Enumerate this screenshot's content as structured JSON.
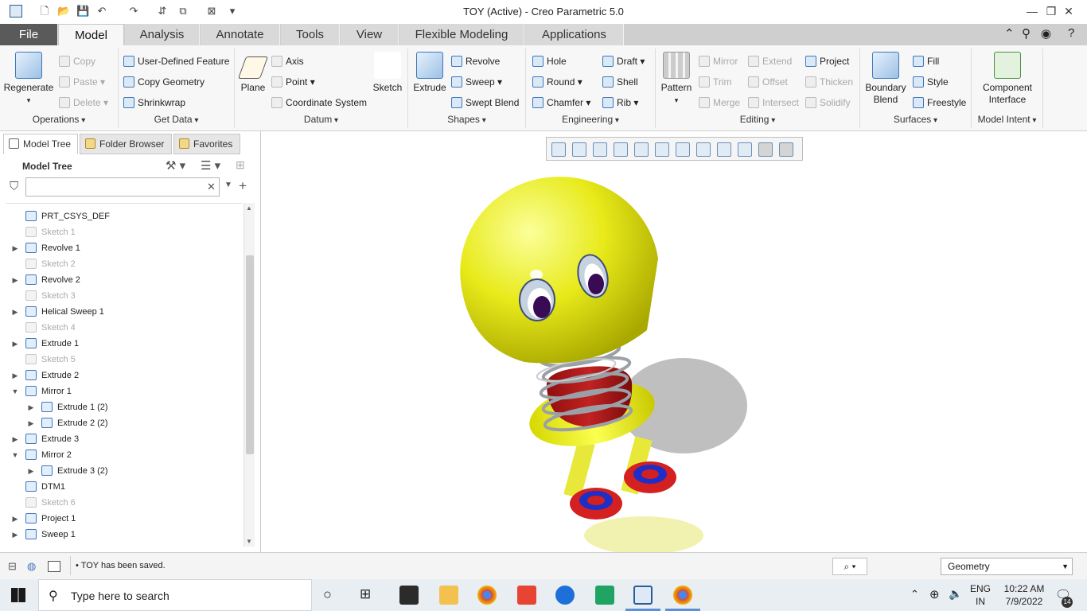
{
  "window": {
    "title": "TOY (Active) - Creo Parametric 5.0"
  },
  "tabs": [
    {
      "label": "File"
    },
    {
      "label": "Model"
    },
    {
      "label": "Analysis"
    },
    {
      "label": "Annotate"
    },
    {
      "label": "Tools"
    },
    {
      "label": "View"
    },
    {
      "label": "Flexible Modeling"
    },
    {
      "label": "Applications"
    }
  ],
  "ribbon": {
    "operations": {
      "label": "Operations",
      "regenerate": "Regenerate",
      "copy": "Copy",
      "paste": "Paste",
      "delete": "Delete"
    },
    "get_data": {
      "label": "Get Data",
      "udf": "User-Defined Feature",
      "copy_geometry": "Copy Geometry",
      "shrinkwrap": "Shrinkwrap"
    },
    "datum": {
      "label": "Datum",
      "plane": "Plane",
      "axis": "Axis",
      "point": "Point",
      "csys": "Coordinate System",
      "sketch": "Sketch"
    },
    "shapes": {
      "label": "Shapes",
      "extrude": "Extrude",
      "revolve": "Revolve",
      "sweep": "Sweep",
      "swept_blend": "Swept Blend"
    },
    "engineering": {
      "label": "Engineering",
      "hole": "Hole",
      "round": "Round",
      "chamfer": "Chamfer",
      "draft": "Draft",
      "shell": "Shell",
      "rib": "Rib"
    },
    "editing": {
      "label": "Editing",
      "pattern": "Pattern",
      "mirror": "Mirror",
      "trim": "Trim",
      "merge": "Merge",
      "extend": "Extend",
      "offset": "Offset",
      "intersect": "Intersect",
      "project": "Project",
      "thicken": "Thicken",
      "solidify": "Solidify"
    },
    "surfaces": {
      "label": "Surfaces",
      "boundary_blend_1": "Boundary",
      "boundary_blend_2": "Blend",
      "fill": "Fill",
      "style": "Style",
      "freestyle": "Freestyle"
    },
    "model_intent": {
      "label": "Model Intent",
      "component_interface_1": "Component",
      "component_interface_2": "Interface"
    }
  },
  "panel": {
    "tabs": [
      {
        "label": "Model Tree"
      },
      {
        "label": "Folder Browser"
      },
      {
        "label": "Favorites"
      }
    ],
    "title": "Model Tree",
    "filter_placeholder": "",
    "items": [
      {
        "label": "PRT_CSYS_DEF",
        "dim": false,
        "exp": ""
      },
      {
        "label": "Sketch 1",
        "dim": true,
        "exp": ""
      },
      {
        "label": "Revolve 1",
        "dim": false,
        "exp": "▶"
      },
      {
        "label": "Sketch 2",
        "dim": true,
        "exp": ""
      },
      {
        "label": "Revolve 2",
        "dim": false,
        "exp": "▶"
      },
      {
        "label": "Sketch 3",
        "dim": true,
        "exp": ""
      },
      {
        "label": "Helical Sweep 1",
        "dim": false,
        "exp": "▶"
      },
      {
        "label": "Sketch 4",
        "dim": true,
        "exp": ""
      },
      {
        "label": "Extrude 1",
        "dim": false,
        "exp": "▶"
      },
      {
        "label": "Sketch 5",
        "dim": true,
        "exp": ""
      },
      {
        "label": "Extrude 2",
        "dim": false,
        "exp": "▶"
      },
      {
        "label": "Mirror 1",
        "dim": false,
        "exp": "▼"
      },
      {
        "label": "Extrude 1 (2)",
        "dim": false,
        "exp": "▶",
        "indent": 1
      },
      {
        "label": "Extrude 2 (2)",
        "dim": false,
        "exp": "▶",
        "indent": 1
      },
      {
        "label": "Extrude 3",
        "dim": false,
        "exp": "▶"
      },
      {
        "label": "Mirror 2",
        "dim": false,
        "exp": "▼"
      },
      {
        "label": "Extrude 3 (2)",
        "dim": false,
        "exp": "▶",
        "indent": 1
      },
      {
        "label": "DTM1",
        "dim": false,
        "exp": ""
      },
      {
        "label": "Sketch 6",
        "dim": true,
        "exp": ""
      },
      {
        "label": "Project 1",
        "dim": false,
        "exp": "▶"
      },
      {
        "label": "Sweep 1",
        "dim": false,
        "exp": "▶"
      }
    ]
  },
  "status": {
    "message": "TOY has been saved.",
    "filter": "Geometry"
  },
  "taskbar": {
    "search_placeholder": "Type here to search",
    "lang1": "ENG",
    "lang2": "IN",
    "time": "10:22 AM",
    "date": "7/9/2022",
    "notif_count": "14"
  }
}
